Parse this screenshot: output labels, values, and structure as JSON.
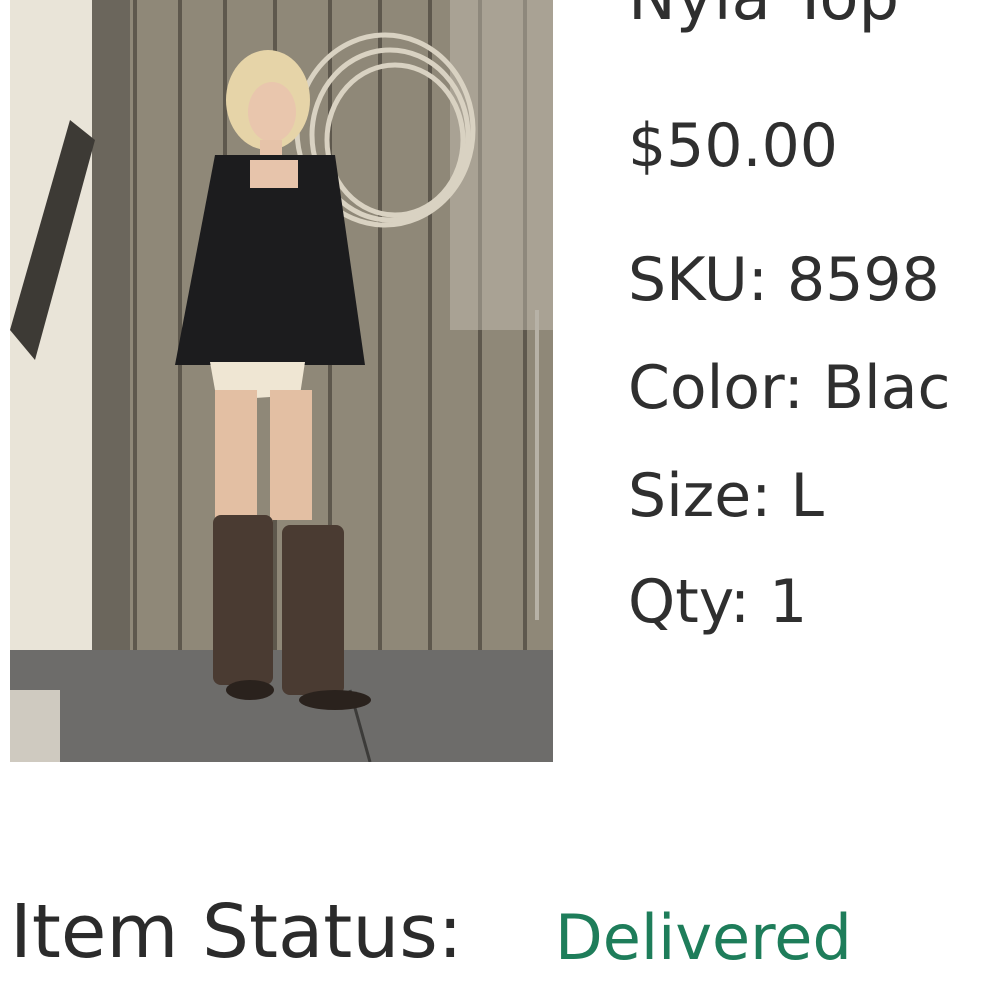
{
  "product": {
    "title": "Nyla Top",
    "price": "$50.00",
    "sku": "SKU: 8598",
    "color": "Color: Blac",
    "size": "Size: L",
    "qty": "Qty: 1"
  },
  "status": {
    "label": "Item Status:",
    "value": "Delivered",
    "value_color": "#1e7d5a"
  }
}
